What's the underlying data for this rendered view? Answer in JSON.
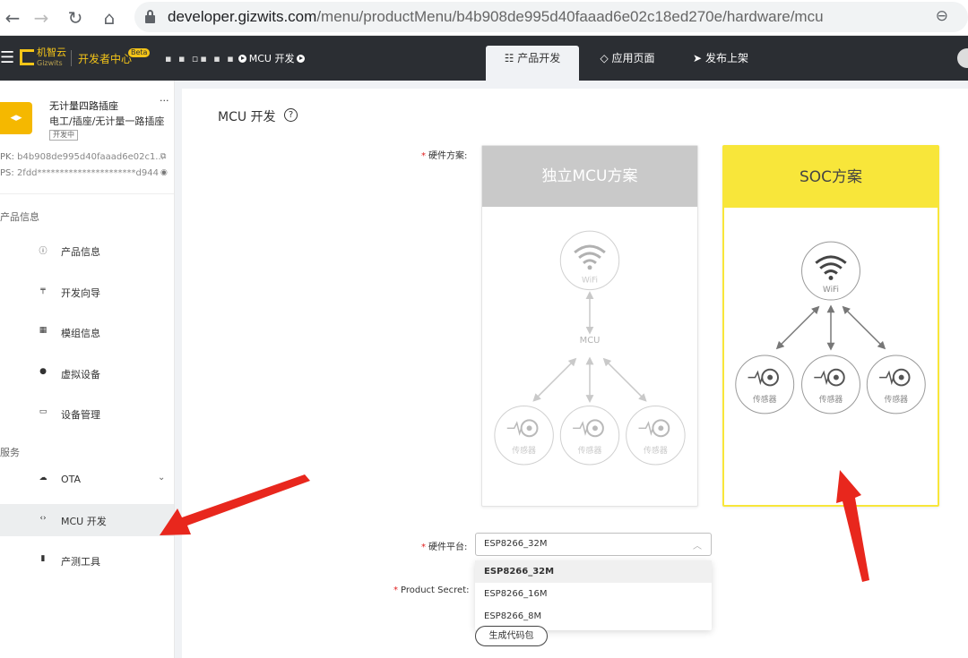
{
  "browser": {
    "url_host": "developer.gizwits.com",
    "url_path": "/menu/productMenu/b4b908de995d40faaad6e02c18ed270e/hardware/mcu"
  },
  "header": {
    "logo_name": "机智云",
    "logo_sub": "Gizwits",
    "dev_center": "开发者中心",
    "beta": "Beta",
    "breadcrumb_current": "MCU 开发",
    "tabs": [
      "产品开发",
      "应用页面",
      "发布上架"
    ]
  },
  "sidebar": {
    "product_name": "无计量四路插座",
    "product_category": "电工/插座/无计量一路插座",
    "product_status": "开发中",
    "more": "···",
    "pk_label": "PK:",
    "pk_value": "b4b908de995d40faaad6e02c1...",
    "ps_label": "PS:",
    "ps_value": "2fdd**********************d944",
    "section_product": "产品信息",
    "section_service": "服务",
    "items": [
      {
        "label": "产品信息"
      },
      {
        "label": "开发向导"
      },
      {
        "label": "模组信息"
      },
      {
        "label": "虚拟设备"
      },
      {
        "label": "设备管理"
      },
      {
        "label": "OTA"
      },
      {
        "label": "MCU 开发"
      },
      {
        "label": "产测工具"
      }
    ]
  },
  "main": {
    "title": "MCU 开发",
    "hw_scheme_label": "硬件方案:",
    "cards": [
      {
        "title": "独立MCU方案",
        "hub": "MCU",
        "wifi": "WiFi",
        "sensor": "传感器"
      },
      {
        "title": "SOC方案",
        "wifi": "WiFi",
        "sensor": "传感器"
      }
    ],
    "platform_label": "硬件平台:",
    "platform_value": "ESP8266_32M",
    "platform_options": [
      "ESP8266_32M",
      "ESP8266_16M",
      "ESP8266_8M"
    ],
    "product_secret_label": "Product Secret:",
    "generate_button": "生成代码包"
  },
  "colors": {
    "header_bg": "#2b2e33",
    "brand_yellow": "#f5c518",
    "soc_accent": "#f8e63a",
    "annotation_arrow": "#e8271d"
  }
}
